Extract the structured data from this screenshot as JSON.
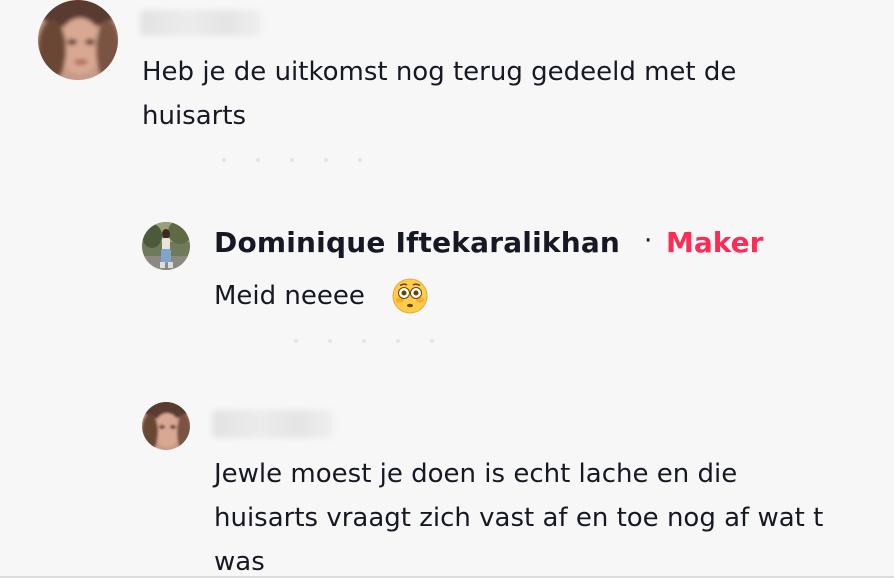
{
  "comments": [
    {
      "author": "",
      "text_lines": [
        "Heb je de uitkomst nog terug gedeeld met de",
        "huisarts"
      ]
    },
    {
      "author": "Dominique Iftekaralikhan",
      "separator": "·",
      "badge": "Maker",
      "text": "Meid neeee",
      "emoji": "flushed-face-emoji"
    },
    {
      "author": "",
      "text_lines": [
        "Jewle moest je doen is echt lache en die",
        "huisarts vraagt zich vast af en toe nog af wat t",
        "was"
      ]
    }
  ],
  "colors": {
    "background": "#f7f7f7",
    "text": "#161823",
    "maker_badge": "#fe2c55"
  }
}
